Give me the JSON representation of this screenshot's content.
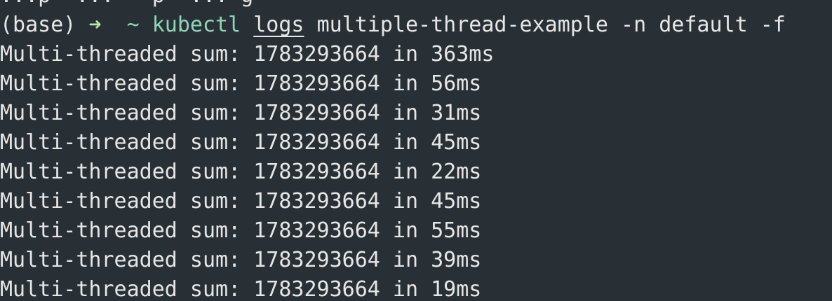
{
  "colors": {
    "background": "#283036",
    "foreground": "#e6e6e6",
    "accent_green": "#8fd6b8",
    "arrow_green": "#b7e6a8"
  },
  "terminal": {
    "partial_line": "...p  ...   p  ... g",
    "prompt": {
      "env": "(base)",
      "arrow": "➜",
      "dir": "~",
      "command": "kubectl",
      "subcommand": "logs",
      "args": "multiple-thread-example -n default -f"
    },
    "output": [
      "Multi-threaded sum: 1783293664 in 363ms",
      "Multi-threaded sum: 1783293664 in 56ms",
      "Multi-threaded sum: 1783293664 in 31ms",
      "Multi-threaded sum: 1783293664 in 45ms",
      "Multi-threaded sum: 1783293664 in 22ms",
      "Multi-threaded sum: 1783293664 in 45ms",
      "Multi-threaded sum: 1783293664 in 55ms",
      "Multi-threaded sum: 1783293664 in 39ms",
      "Multi-threaded sum: 1783293664 in 19ms"
    ]
  }
}
